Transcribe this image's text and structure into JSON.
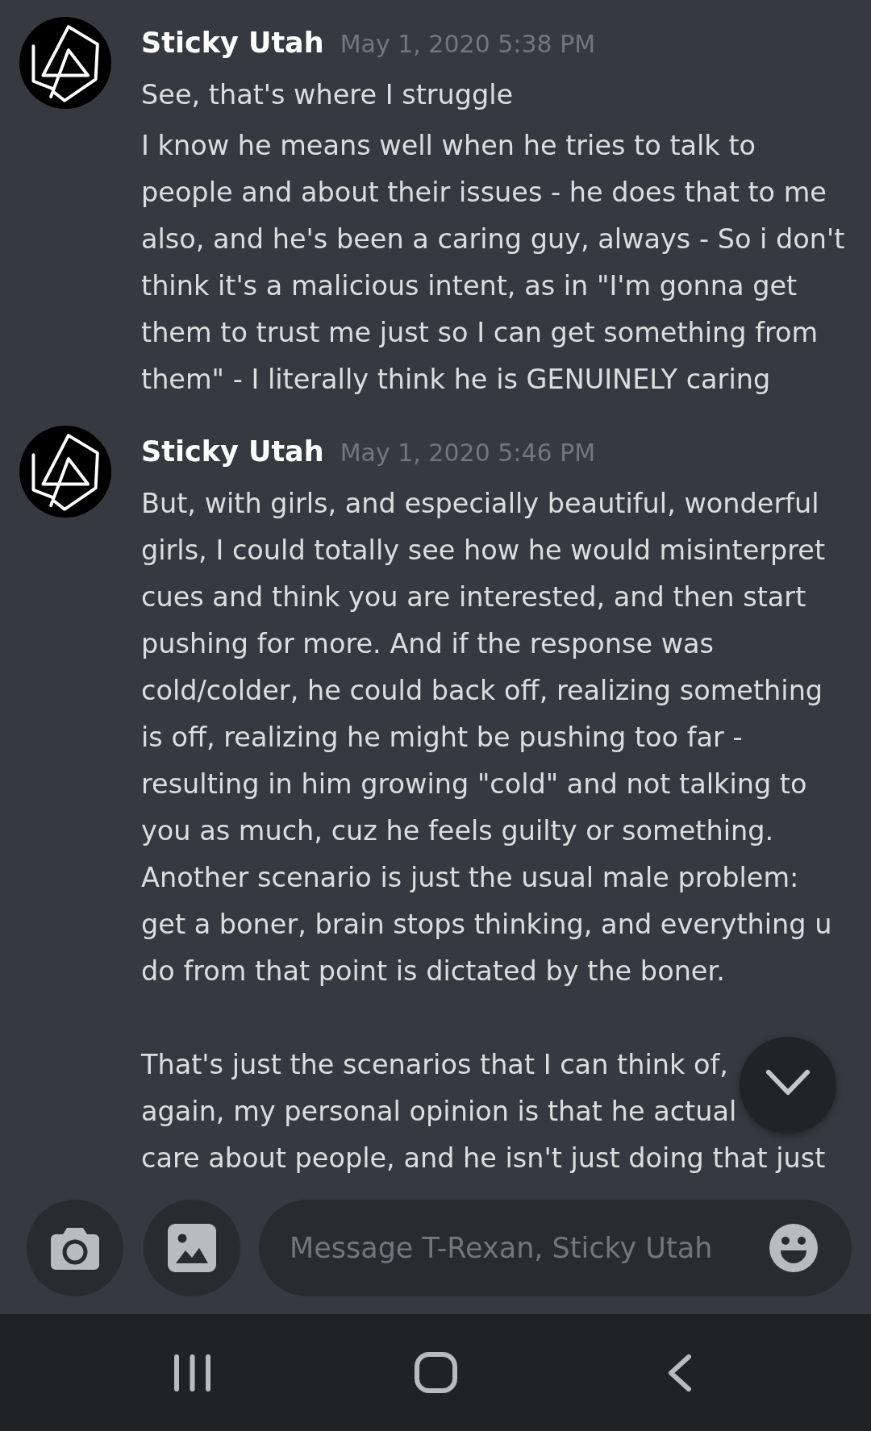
{
  "messages": [
    {
      "author": "Sticky Utah",
      "timestamp": "May 1, 2020 5:38 PM",
      "contents": [
        "See, that's where I struggle",
        "I know he means well when he tries to talk to people and about their issues - he does that to me also, and he's been a caring guy, always - So i don't think it's a malicious intent, as in \"I'm gonna get them to trust me just so I can get something from them\" - I literally think he is GENUINELY caring"
      ]
    },
    {
      "author": "Sticky Utah",
      "timestamp": "May 1, 2020 5:46 PM",
      "contents": [
        "But, with girls, and especially beautiful, wonderful girls, I could totally see how he would misinterpret cues and think you are interested, and then start pushing for more. And if the response was cold/colder, he could back off, realizing something is off, realizing he might be pushing too far - resulting in him growing \"cold\" and not talking to you as much, cuz he feels guilty or something. Another scenario is just the usual male problem: get a boner, brain stops thinking, and everything u do from that point is dictated by the boner."
      ],
      "partly_covered_lines": [
        "That's just the scenarios that I can think of,",
        "again, my personal opinion is that he actual",
        "care about people, and he isn't just doing that just"
      ]
    }
  ],
  "composer": {
    "placeholder": "Message T-Rexan, Sticky Utah"
  }
}
